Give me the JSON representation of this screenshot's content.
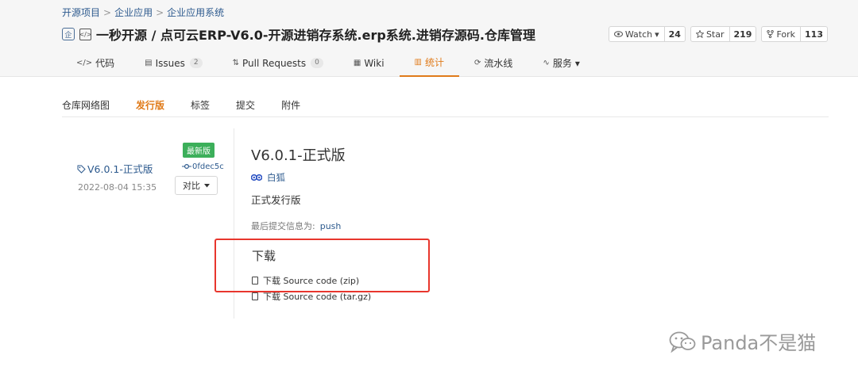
{
  "breadcrumb": [
    "开源项目",
    "企业应用",
    "企业应用系统"
  ],
  "breadcrumb_sep": ">",
  "repo": {
    "title": "一秒开源 / 点可云ERP-V6.0-开源进销存系统.erp系统.进销存源码.仓库管理",
    "ent_icon": "企",
    "code_icon": "</>"
  },
  "actions": [
    {
      "label": "Watch",
      "count": "24",
      "icon": "eye-icon",
      "caret": "▾"
    },
    {
      "label": "Star",
      "count": "219",
      "icon": "star-icon"
    },
    {
      "label": "Fork",
      "count": "113",
      "icon": "fork-icon"
    }
  ],
  "tabs": [
    {
      "label": "代码",
      "icon": "</>"
    },
    {
      "label": "Issues",
      "badge": "2",
      "icon": "▤"
    },
    {
      "label": "Pull Requests",
      "badge": "0",
      "icon": "⇅"
    },
    {
      "label": "Wiki",
      "icon": "▦"
    },
    {
      "label": "统计",
      "icon": "▥",
      "active": true
    },
    {
      "label": "流水线",
      "icon": "⟳"
    },
    {
      "label": "服务",
      "icon": "∿",
      "caret": "▾"
    }
  ],
  "subnav": [
    "仓库网络图",
    "发行版",
    "标签",
    "提交",
    "附件"
  ],
  "release": {
    "latest_badge": "最新版",
    "tag": "V6.0.1-正式版",
    "commit": "0fdec5c",
    "date": "2022-08-04 15:35",
    "compare": "对比",
    "title": "V6.0.1-正式版",
    "author": "白狐",
    "description": "正式发行版",
    "last_commit_label": "最后提交信息为:",
    "last_commit_value": "push",
    "downloads_title": "下载",
    "downloads": [
      "下载 Source code (zip)",
      "下载 Source code (tar.gz)"
    ]
  },
  "watermark": "Panda不是猫",
  "colors": {
    "accent": "#e07b1a",
    "link": "#2d5a8e",
    "badge_green": "#3caf5a",
    "highlight_red": "#e8362d"
  }
}
